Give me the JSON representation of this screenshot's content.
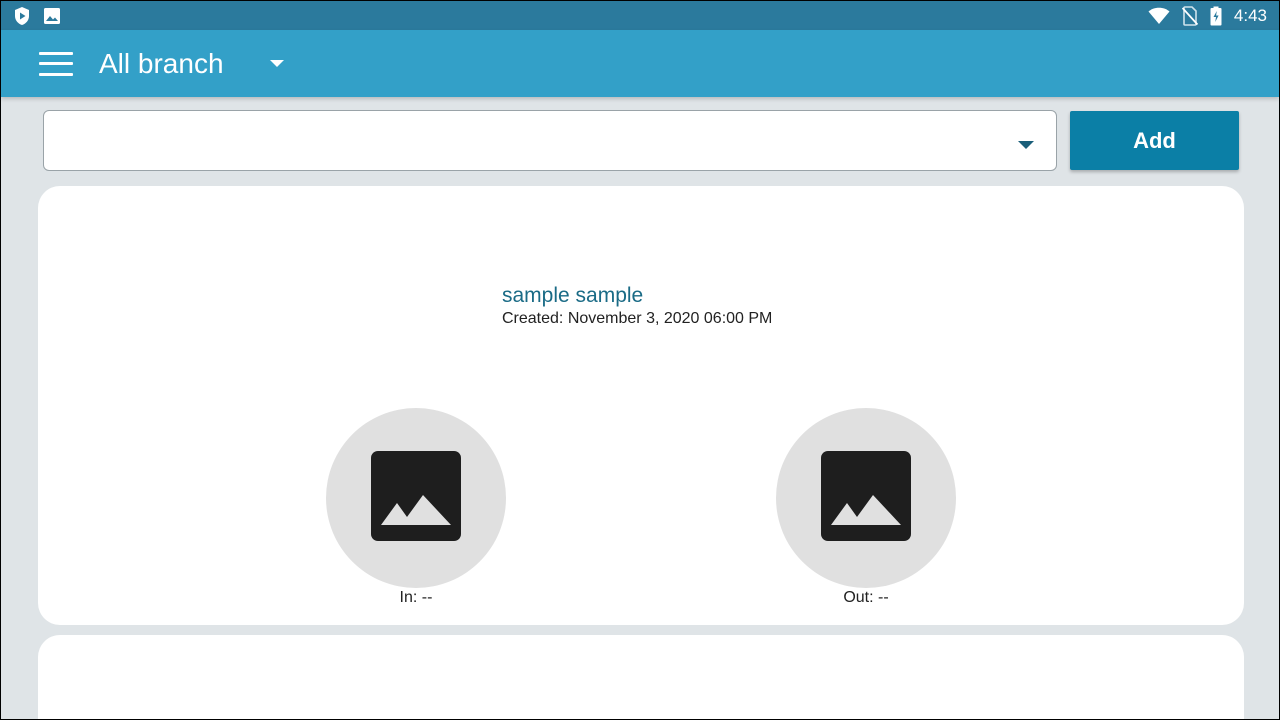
{
  "status_bar": {
    "time": "4:43",
    "left_icons": [
      "shield-app-icon",
      "image-notification-icon"
    ],
    "right_icons": [
      "wifi-icon",
      "no-sim-icon",
      "battery-charging-icon"
    ]
  },
  "app_bar": {
    "menu_icon": "hamburger-menu-icon",
    "title": "All branch",
    "title_dropdown_icon": "caret-down-icon"
  },
  "filter": {
    "selected_value": "",
    "dropdown_icon": "caret-down-icon"
  },
  "add_button": {
    "label": "Add"
  },
  "records": [
    {
      "name": "sample sample",
      "created": "Created: November 3, 2020 06:00 PM",
      "in_label": "In: --",
      "out_label": "Out: --",
      "photo_icon": "image-placeholder-icon"
    }
  ],
  "colors": {
    "status_bar": "#2b7a9d",
    "app_bar": "#33a0c8",
    "add_button": "#0b7fa6",
    "background": "#dfe4e7",
    "record_name": "#1a6b86"
  }
}
